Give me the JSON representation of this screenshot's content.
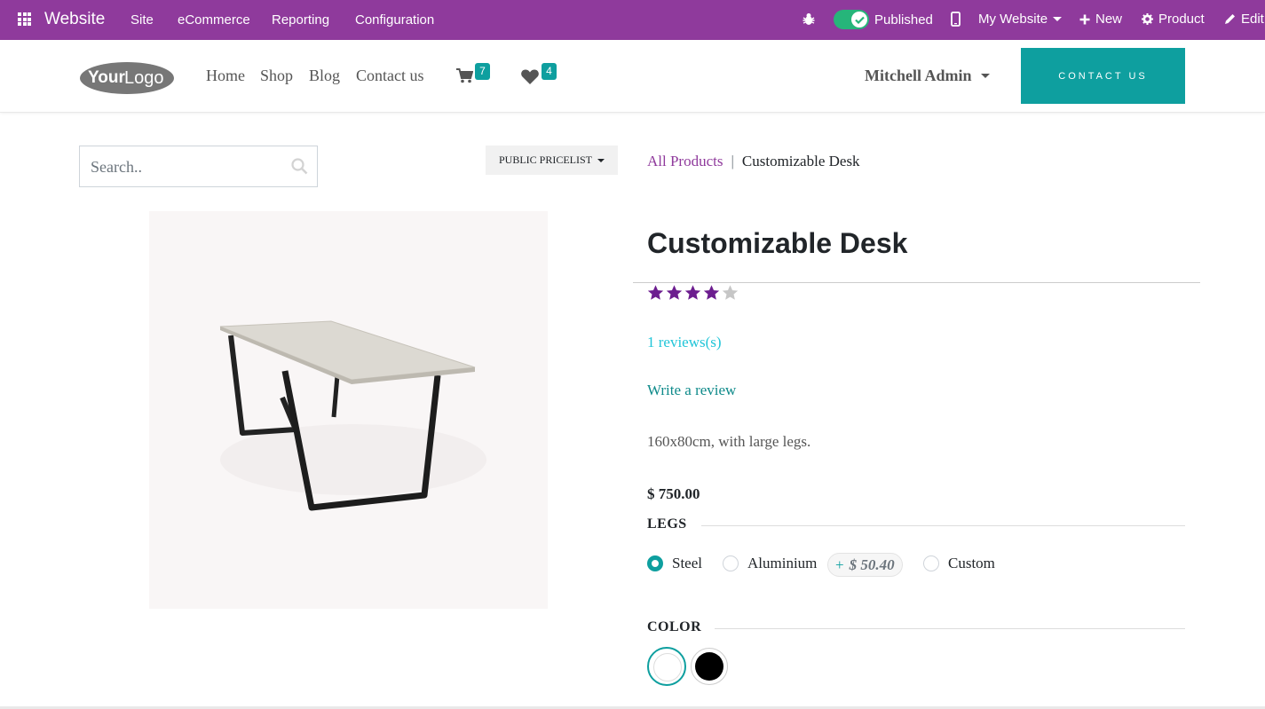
{
  "admin_bar": {
    "app_name": "Website",
    "menus": [
      "Site",
      "eCommerce",
      "Reporting",
      "Configuration"
    ],
    "published_label": "Published",
    "published": true,
    "website_label": "My Website",
    "new_label": "New",
    "product_label": "Product",
    "edit_label": "Edit",
    "color": "#8f3a9c"
  },
  "header": {
    "logo_text_1": "Your",
    "logo_text_2": "Logo",
    "nav": [
      "Home",
      "Shop",
      "Blog",
      "Contact us"
    ],
    "cart_count": "7",
    "wishlist_count": "4",
    "user_name": "Mitchell Admin",
    "contact_button": "CONTACT US",
    "accent_color": "#0e9f9f"
  },
  "search": {
    "placeholder": "Search.."
  },
  "pricelist": {
    "label": "PUBLIC PRICELIST"
  },
  "breadcrumb": {
    "parent": "All Products",
    "current": "Customizable Desk"
  },
  "product": {
    "title": "Customizable Desk",
    "rating": 4,
    "rating_max": 5,
    "reviews_link": "1 reviews(s)",
    "write_review": "Write a review",
    "description": "160x80cm, with large legs.",
    "price": "$ 750.00"
  },
  "legs": {
    "label": "LEGS",
    "options": [
      {
        "name": "Steel",
        "selected": true
      },
      {
        "name": "Aluminium",
        "selected": false,
        "extra_sign": "+",
        "extra_price": "$ 50.40"
      },
      {
        "name": "Custom",
        "selected": false
      }
    ]
  },
  "color": {
    "label": "COLOR",
    "swatches": [
      {
        "name": "white",
        "hex": "#ffffff",
        "selected": true
      },
      {
        "name": "black",
        "hex": "#000000",
        "selected": false
      }
    ]
  }
}
